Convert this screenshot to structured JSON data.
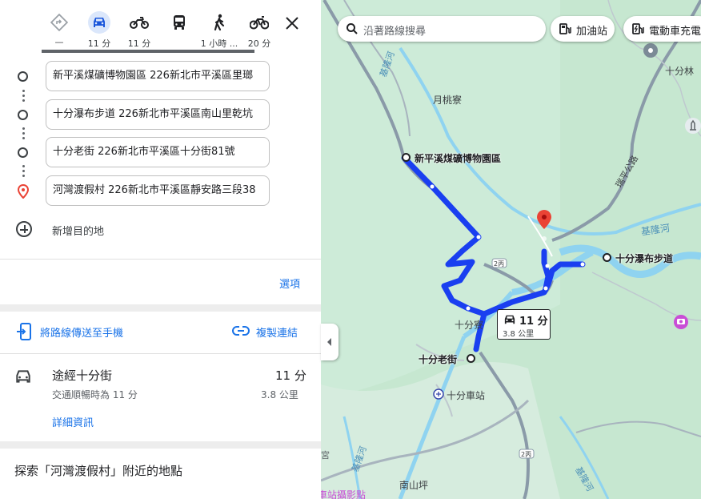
{
  "travel_modes": [
    {
      "name": "best-route",
      "time": "—",
      "active": false
    },
    {
      "name": "driving",
      "time": "11 分",
      "active": true
    },
    {
      "name": "motorcycle",
      "time": "11 分",
      "active": false
    },
    {
      "name": "transit",
      "time": "",
      "active": false
    },
    {
      "name": "walking",
      "time": "1 小時 ...",
      "active": false
    },
    {
      "name": "cycling",
      "time": "20 分",
      "active": false
    }
  ],
  "stops": [
    {
      "value": "新平溪煤礦博物園區 226新北市平溪區里瑯"
    },
    {
      "value": "十分瀑布步道 226新北市平溪區南山里乾坑"
    },
    {
      "value": "十分老街 226新北市平溪區十分街81號"
    },
    {
      "value": "河灣渡假村 226新北市平溪區靜安路三段38"
    }
  ],
  "add_destination": "新增目的地",
  "options_label": "選項",
  "send_to_phone": "將路線傳送至手機",
  "copy_link": "複製連結",
  "route": {
    "title": "途經十分街",
    "time": "11 分",
    "subtitle": "交通順暢時為 11 分",
    "distance": "3.8 公里",
    "details": "詳細資訊"
  },
  "explore": "探索「河灣渡假村」附近的地點",
  "map": {
    "search_placeholder": "沿著路線搜尋",
    "chips": [
      "加油站",
      "電動車充電"
    ],
    "labels": {
      "poi_museum": "新平溪煤礦博物園區",
      "poi_waterfall": "十分瀑布步道",
      "poi_oldstreet": "十分老街",
      "station": "十分車站",
      "yuetaoliao": "月桃寮",
      "shifenliao": "十分寮",
      "nanshanping": "南山坪",
      "keelung_river": "基隆河",
      "keelung_river_2": "基隆河",
      "keelung_river_3": "基隆河",
      "keelung_river_4": "基隆河",
      "ruiping_rd": "瑞平公路",
      "shifen_lin": "十分林",
      "road_2bing": "2丙",
      "road_2bing_b": "2丙",
      "photo_place": "車站攝影點",
      "gong": "宮"
    },
    "route_bubble": {
      "time": "11 分",
      "distance": "3.8 公里"
    }
  },
  "colors": {
    "route": "#1a3ff0",
    "accent": "#1a73e8",
    "map_bg": "#cdebd8",
    "water": "#8fd3f0",
    "pin": "#ea4335"
  }
}
